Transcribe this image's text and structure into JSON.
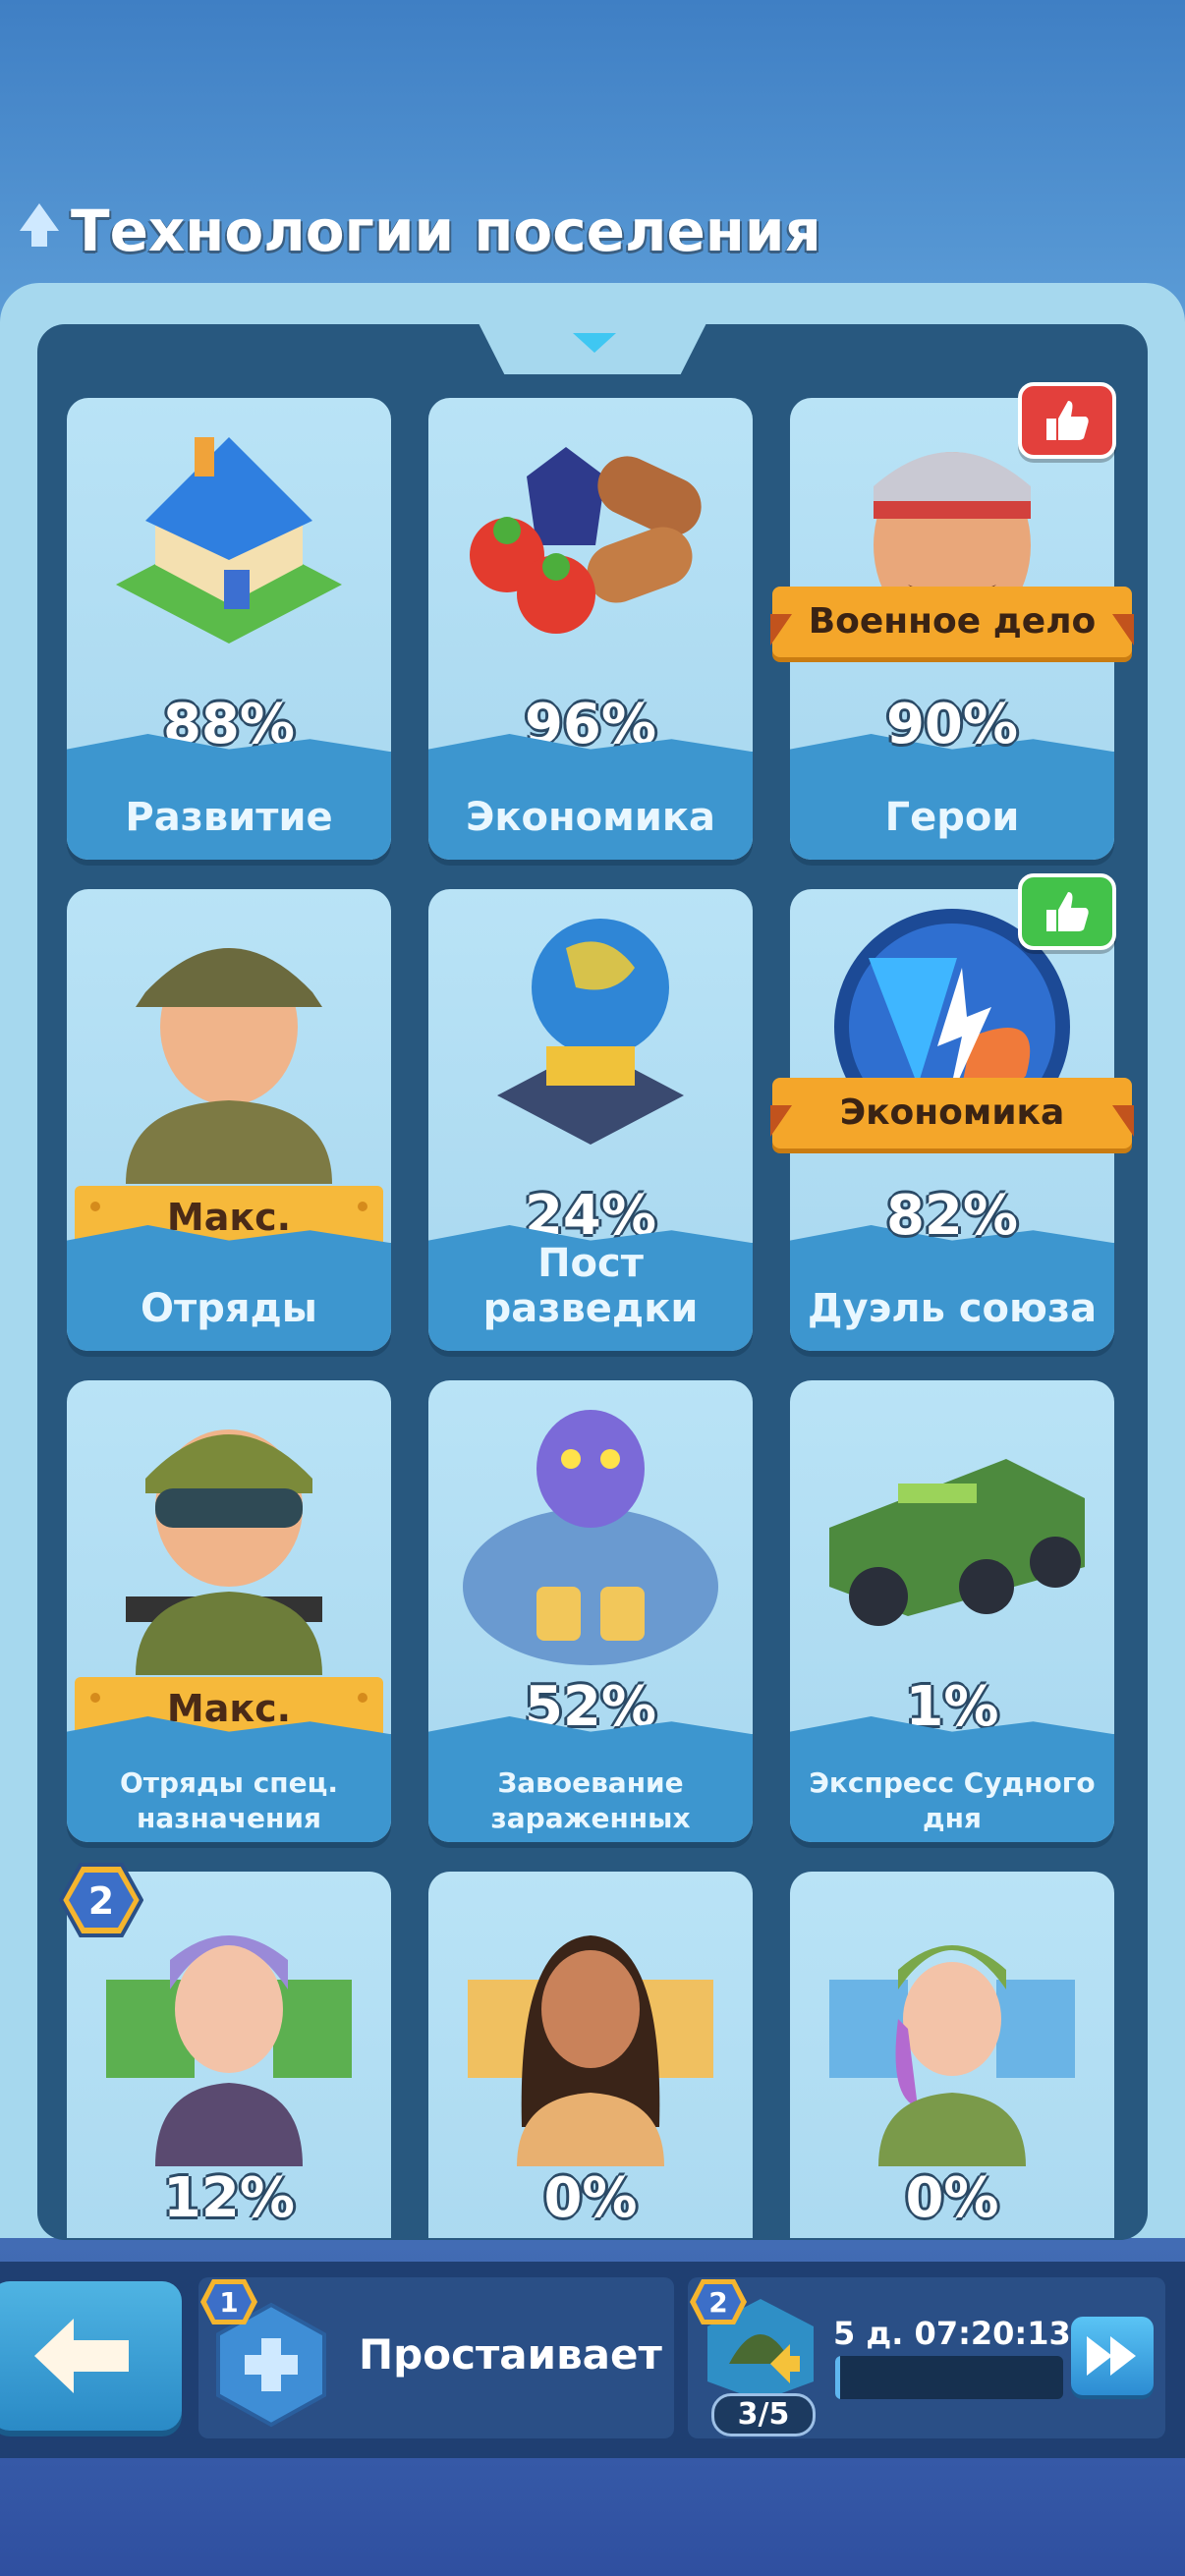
{
  "page_title": "Технологии поселения",
  "colors": {
    "panel": "#28587f",
    "card": "#b9e3f6",
    "card_bottom": "#3d96cf",
    "ribbon": "#f6b93b",
    "recommend_red": "#e3403c",
    "recommend_green": "#43c24a"
  },
  "cards": [
    {
      "percent": "88%",
      "label": "Развитие",
      "icon": "house-icon"
    },
    {
      "percent": "96%",
      "label": "Экономика",
      "icon": "resources-icon"
    },
    {
      "percent": "90%",
      "label": "Герои",
      "icon": "hero-portrait-icon",
      "banner": "Военное дело",
      "recommend": "red"
    },
    {
      "status": "Макс.",
      "label": "Отряды",
      "icon": "soldier-icon"
    },
    {
      "percent": "24%",
      "label": "Пост разведки",
      "icon": "globe-station-icon"
    },
    {
      "percent": "82%",
      "label": "Дуэль союза",
      "icon": "versus-icon",
      "banner": "Экономика",
      "recommend": "green"
    },
    {
      "status": "Макс.",
      "label": "Отряды спец. назначения",
      "icon": "special-forces-icon"
    },
    {
      "percent": "52%",
      "label": "Завоевание зараженных",
      "icon": "zombie-icon"
    },
    {
      "percent": "1%",
      "label": "Экспресс Судного дня",
      "icon": "truck-icon"
    },
    {
      "percent": "12%",
      "label": "",
      "icon": "heroine-1-icon",
      "badge": "2"
    },
    {
      "percent": "0%",
      "label": "",
      "icon": "heroine-2-icon"
    },
    {
      "percent": "0%",
      "label": "",
      "icon": "heroine-3-icon"
    }
  ],
  "bottom_bar": {
    "slot1_badge": "1",
    "slot1_status": "Простаивает",
    "slot2_badge": "2",
    "slot2_timer": "5 д. 07:20:13",
    "slot2_count": "3/5",
    "slot2_progress": 0.02
  }
}
